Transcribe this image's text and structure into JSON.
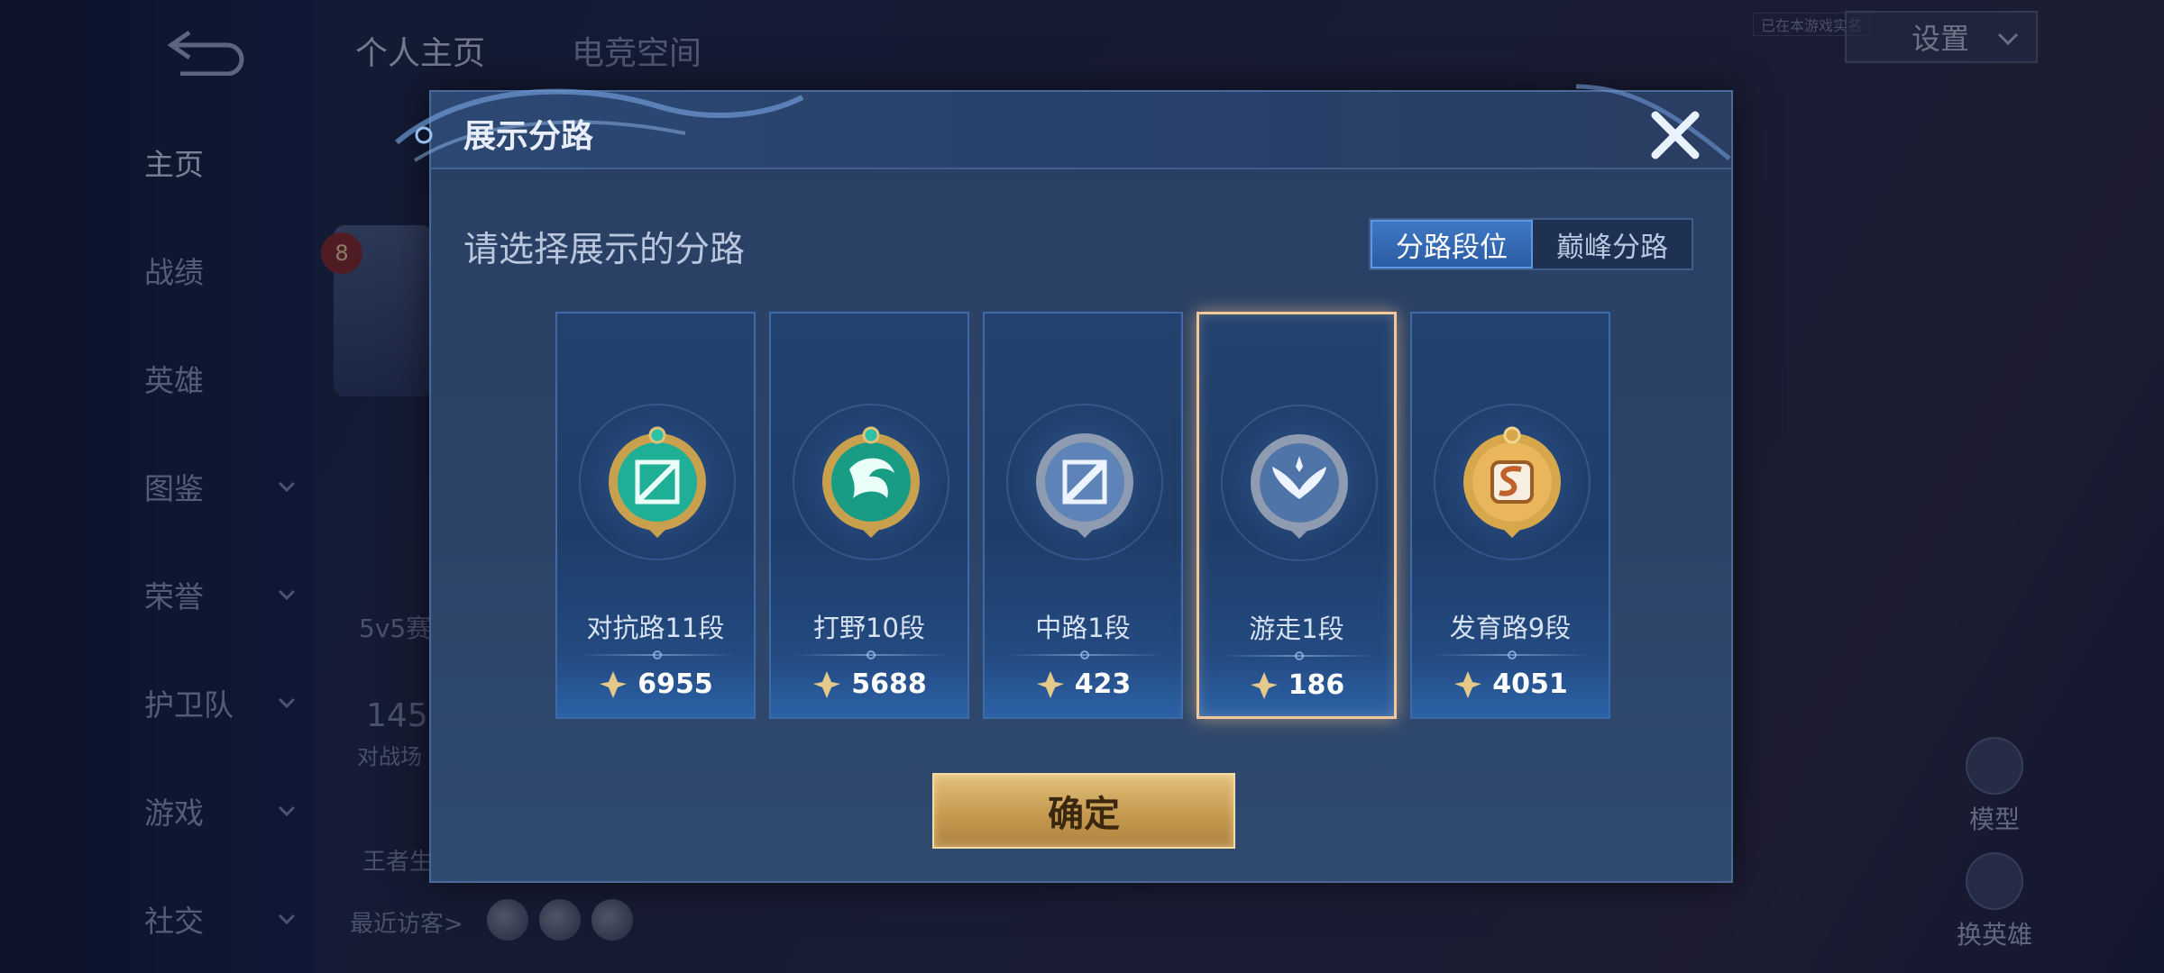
{
  "background": {
    "nav_items": [
      {
        "label": "主页",
        "has_chevron": false,
        "active": true
      },
      {
        "label": "战绩",
        "has_chevron": false,
        "active": false
      },
      {
        "label": "英雄",
        "has_chevron": false,
        "active": false
      },
      {
        "label": "图鉴",
        "has_chevron": true,
        "active": false
      },
      {
        "label": "荣誉",
        "has_chevron": true,
        "active": false
      },
      {
        "label": "护卫队",
        "has_chevron": true,
        "active": false
      },
      {
        "label": "游戏",
        "has_chevron": true,
        "active": false
      },
      {
        "label": "社交",
        "has_chevron": true,
        "active": false
      }
    ],
    "top_tabs": [
      "个人主页",
      "电竞空间"
    ],
    "settings_label": "设置",
    "tiny_tag": "已在本游戏实名",
    "level": "8",
    "partials": [
      "5v5赛",
      "145",
      "对战场",
      "王者生"
    ],
    "visitors_label": "最近访客>",
    "right_icons": [
      "模型",
      "换英雄"
    ]
  },
  "modal": {
    "title": "展示分路",
    "subtitle": "请选择展示的分路",
    "toggle": [
      "分路段位",
      "巅峰分路"
    ],
    "toggle_active_index": 0,
    "confirm_label": "确定",
    "cards": [
      {
        "label": "对抗路11段",
        "score": "6955",
        "emblem": "clash-lane-emblem",
        "selected": false
      },
      {
        "label": "打野10段",
        "score": "5688",
        "emblem": "jungle-emblem",
        "selected": false
      },
      {
        "label": "中路1段",
        "score": "423",
        "emblem": "mid-lane-emblem",
        "selected": false
      },
      {
        "label": "游走1段",
        "score": "186",
        "emblem": "roam-emblem",
        "selected": true
      },
      {
        "label": "发育路9段",
        "score": "4051",
        "emblem": "farm-lane-emblem",
        "selected": false
      }
    ]
  },
  "colors": {
    "accent_blue": "#3f78c4",
    "confirm_gold": "#c59a4f",
    "selected_border": "#f0c89a"
  }
}
